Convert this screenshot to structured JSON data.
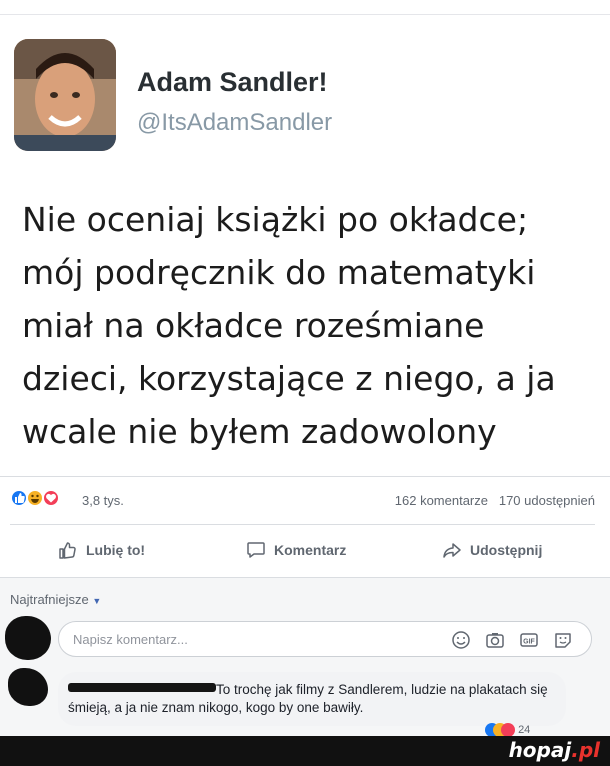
{
  "tweet": {
    "name": "Adam Sandler!",
    "handle": "@ItsAdamSandler",
    "text": "Nie oceniaj książki po okładce;\nmój podręcznik do matematyki\nmiał na okładce roześmiane\ndzieci, korzystające z niego, a ja\nwcale nie byłem zadowolony"
  },
  "post_stats": {
    "reactions_count": "3,8 tys.",
    "comments": "162 komentarze",
    "shares": "170 udostępnień",
    "reaction_icons": [
      "like-icon",
      "haha-icon",
      "love-icon"
    ]
  },
  "actions": {
    "like": "Lubię to!",
    "comment": "Komentarz",
    "share": "Udostępnij"
  },
  "comments_section": {
    "sort_label": "Najtrafniejsze",
    "input_placeholder": "Napisz komentarz...",
    "input_icons": [
      "emoji-icon",
      "camera-icon",
      "gif-icon",
      "sticker-icon"
    ],
    "comment": {
      "text": "To trochę jak filmy z Sandlerem, ludzie na plakatach się śmieją, a ja nie znam nikogo, kogo by one bawiły.",
      "reactions_count": "24"
    }
  },
  "watermark": {
    "logo_main": "hopaj",
    "logo_tld": ".pl"
  },
  "colors": {
    "like_blue": "#1877f2",
    "haha_yellow": "#f7b125",
    "love_red": "#f33e58",
    "footer_bg": "#111111"
  }
}
